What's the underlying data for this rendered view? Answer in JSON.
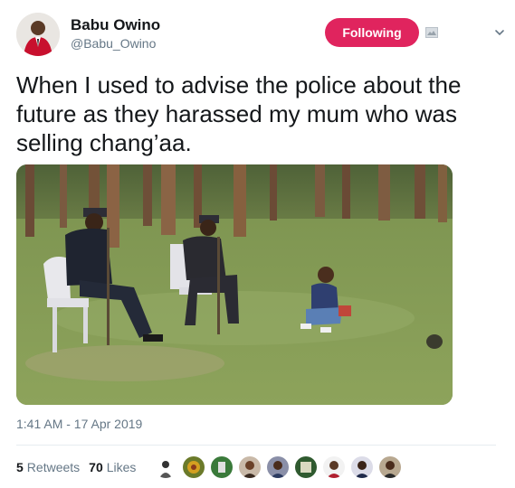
{
  "author": {
    "name": "Babu Owino",
    "handle": "@Babu_Owino"
  },
  "follow_button": {
    "label": "Following",
    "color": "#e0245e"
  },
  "tweet": {
    "text_line1": "When I used to advise the police about the",
    "text_line2": "future as they harassed my mum who was",
    "text_line3": "selling chang’aa.",
    "timestamp": "1:41 AM - 17 Apr 2019"
  },
  "stats": {
    "retweets_count": "5",
    "retweets_label": "Retweets",
    "likes_count": "70",
    "likes_label": "Likes"
  },
  "likers": [
    "liker-1",
    "liker-2",
    "liker-3",
    "liker-4",
    "liker-5",
    "liker-6",
    "liker-7",
    "liker-8",
    "liker-9"
  ],
  "colors": {
    "text": "#14171a",
    "secondary": "#657786",
    "accent": "#e0245e",
    "divider": "#e6ecf0"
  }
}
